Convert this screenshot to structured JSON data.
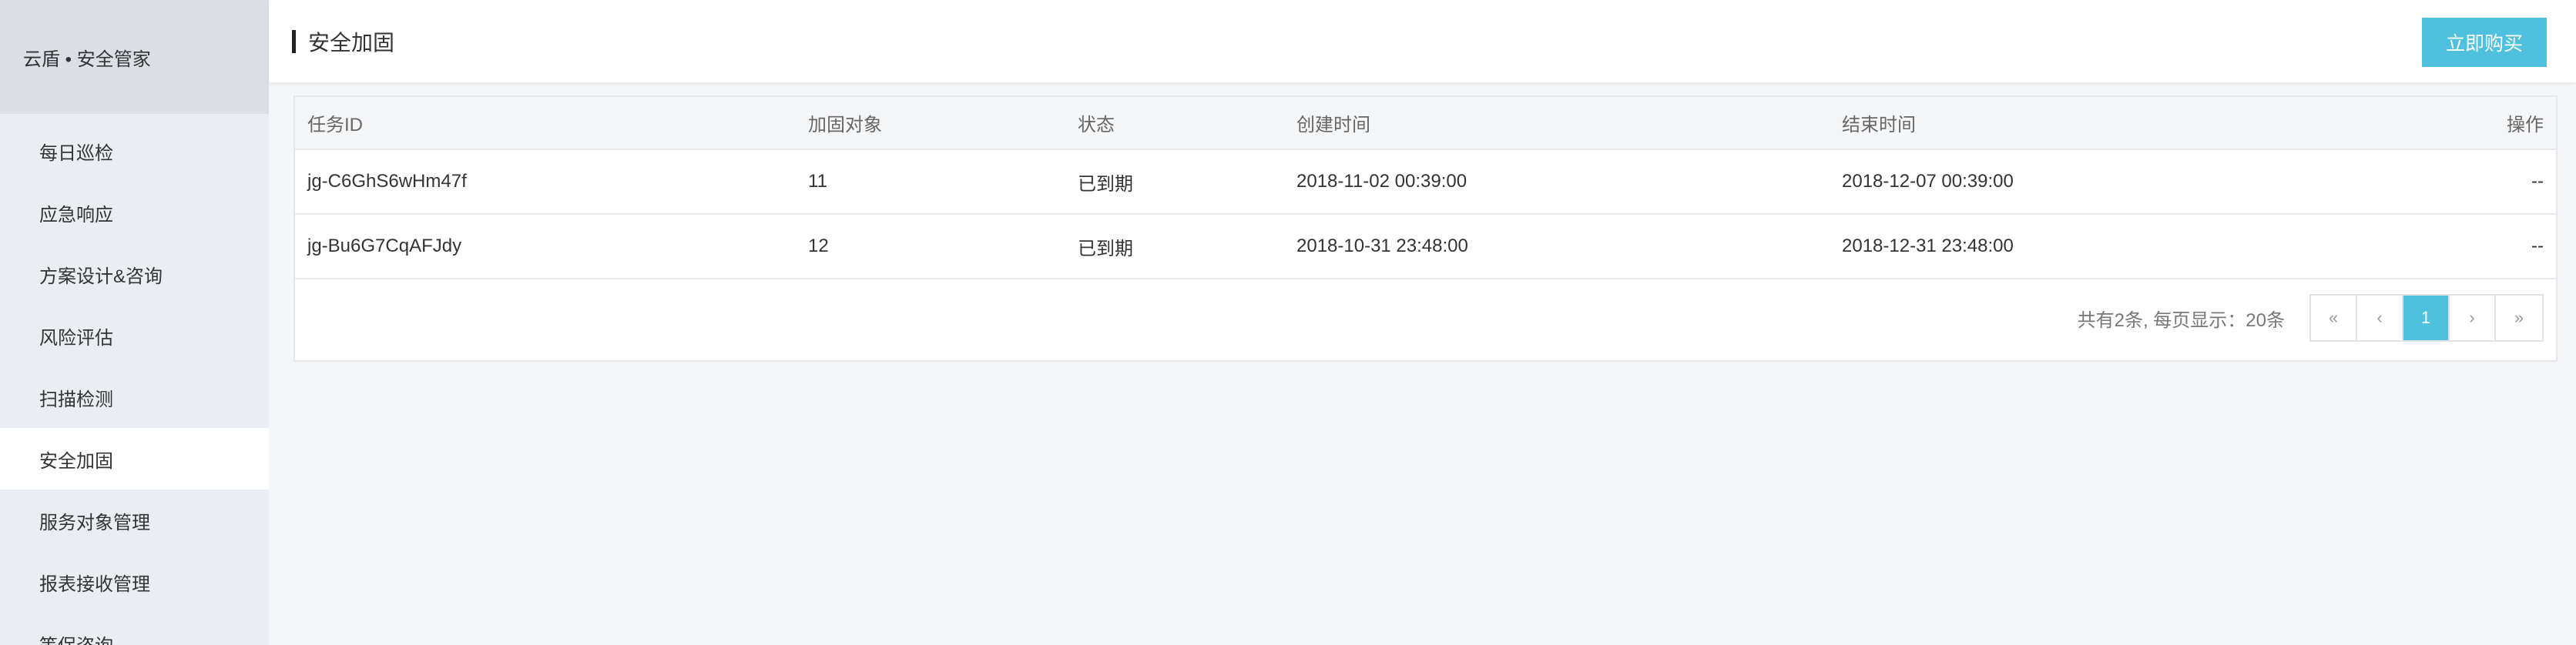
{
  "sidebar": {
    "title": "云盾 • 安全管家",
    "items": [
      {
        "label": "每日巡检"
      },
      {
        "label": "应急响应"
      },
      {
        "label": "方案设计&咨询"
      },
      {
        "label": "风险评估"
      },
      {
        "label": "扫描检测"
      },
      {
        "label": "安全加固"
      },
      {
        "label": "服务对象管理"
      },
      {
        "label": "报表接收管理"
      },
      {
        "label": "等保咨询"
      }
    ],
    "active_index": 5
  },
  "header": {
    "title": "安全加固",
    "buy_label": "立即购买"
  },
  "table": {
    "columns": [
      "任务ID",
      "加固对象",
      "状态",
      "创建时间",
      "结束时间",
      "操作"
    ],
    "rows": [
      [
        "jg-C6GhS6wHm47f",
        "11",
        "已到期",
        "2018-11-02 00:39:00",
        "2018-12-07 00:39:00",
        "--"
      ],
      [
        "jg-Bu6G7CqAFJdy",
        "12",
        "已到期",
        "2018-10-31 23:48:00",
        "2018-12-31 23:48:00",
        "--"
      ]
    ]
  },
  "pagination": {
    "info": "共有2条, 每页显示：20条",
    "first": "«",
    "prev": "‹",
    "current": "1",
    "next": "›",
    "last": "»"
  },
  "colors": {
    "accent": "#4fc1df",
    "sidebar_bg": "#eaedf1",
    "sidebar_header_bg": "#dcdfe5"
  }
}
